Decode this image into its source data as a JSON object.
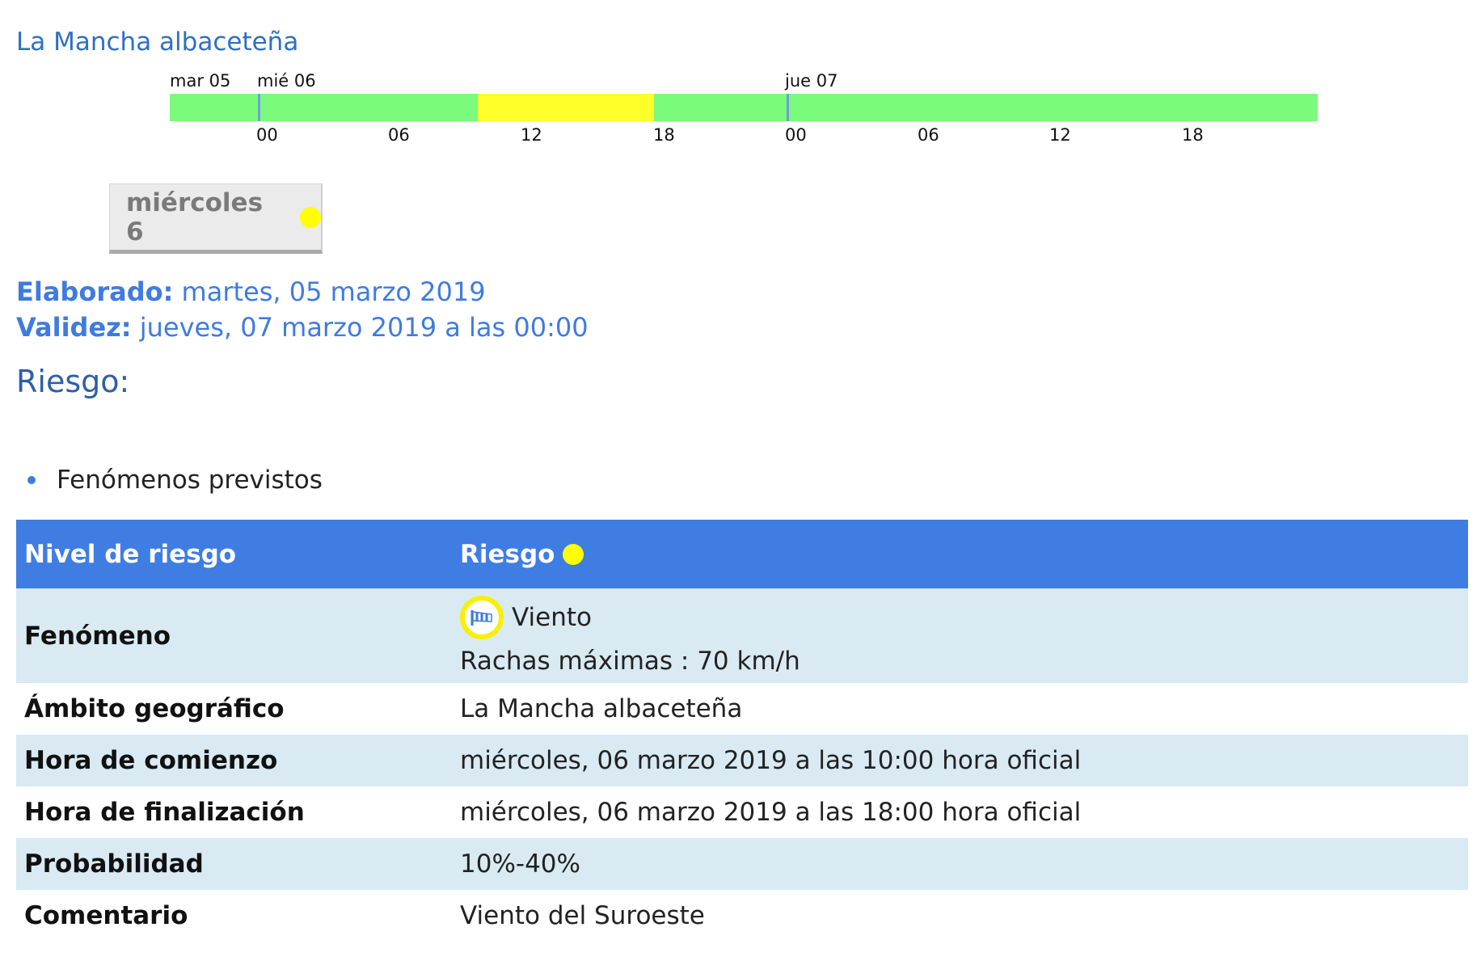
{
  "zone": {
    "title": "La Mancha albaceteña"
  },
  "timeline": {
    "day_labels": [
      "mar 05",
      "mié 06",
      "jue 07"
    ],
    "hour_labels": [
      "00",
      "06",
      "12",
      "18",
      "00",
      "06",
      "12",
      "18"
    ],
    "level_colors": {
      "verde": "#7bfb7b",
      "amarillo": "#ffff2a"
    },
    "marker_color": "#6f9fdc"
  },
  "day_tab": {
    "label": "miércoles 6",
    "level_color": "#ffff00"
  },
  "meta": {
    "elaborado_label": "Elaborado:",
    "elaborado_value": "martes, 05 marzo 2019",
    "validez_label": "Validez:",
    "validez_value": "jueves, 07 marzo 2019 a las 00:00"
  },
  "riesgo_heading": "Riesgo:",
  "list": {
    "item": "Fenómenos previstos"
  },
  "table": {
    "head": {
      "col1": "Nivel de riesgo",
      "col2": "Riesgo",
      "level_color": "#ffff00"
    },
    "fenomeno": {
      "label": "Fenómeno",
      "icon": "wind-icon",
      "name": "Viento",
      "detail": "Rachas máximas : 70 km/h"
    },
    "rows": [
      {
        "label": "Ámbito geográfico",
        "value": "La Mancha albaceteña"
      },
      {
        "label": "Hora de comienzo",
        "value": "miércoles, 06 marzo 2019 a las 10:00 hora oficial"
      },
      {
        "label": "Hora de finalización",
        "value": "miércoles, 06 marzo 2019 a las 18:00 hora oficial"
      },
      {
        "label": "Probabilidad",
        "value": "10%-40%"
      },
      {
        "label": "Comentario",
        "value": "Viento del Suroeste"
      }
    ]
  }
}
